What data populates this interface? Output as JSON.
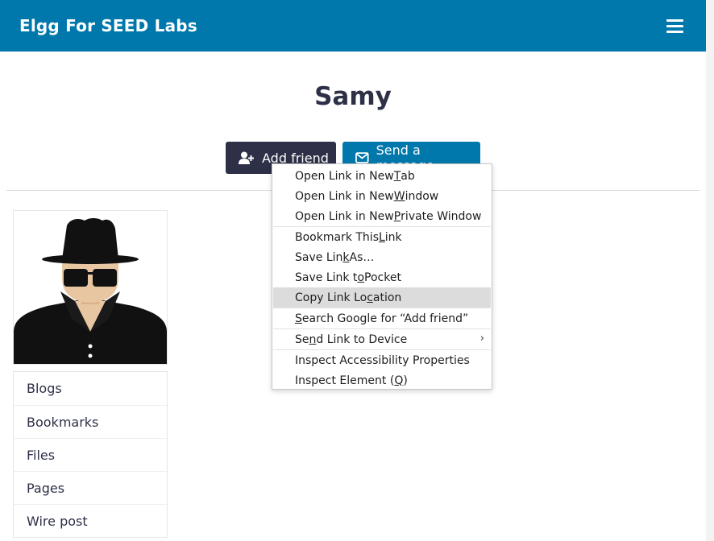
{
  "header": {
    "site_name": "Elgg For SEED Labs"
  },
  "profile": {
    "name": "Samy"
  },
  "actions": {
    "add_friend": "Add friend",
    "send_message": "Send a message"
  },
  "owner_menu": {
    "items": [
      "Blogs",
      "Bookmarks",
      "Files",
      "Pages",
      "Wire post"
    ]
  },
  "context_menu": {
    "items": [
      {
        "pre": "Open Link in New ",
        "key": "T",
        "post": "ab"
      },
      {
        "pre": "Open Link in New ",
        "key": "W",
        "post": "indow"
      },
      {
        "pre": "Open Link in New ",
        "key": "P",
        "post": "rivate Window"
      },
      {
        "pre": "Bookmark This ",
        "key": "L",
        "post": "ink"
      },
      {
        "pre": "Save Lin",
        "key": "k",
        "post": " As…"
      },
      {
        "pre": "Save Link t",
        "key": "o",
        "post": " Pocket"
      },
      {
        "pre": "Copy Link Lo",
        "key": "c",
        "post": "ation"
      },
      {
        "pre": "",
        "key": "S",
        "post": "earch Google for “Add friend”"
      },
      {
        "pre": "Se",
        "key": "n",
        "post": "d Link to Device"
      },
      {
        "pre": "Inspect Accessibility Properties",
        "key": "",
        "post": ""
      },
      {
        "pre": "Inspect Element (",
        "key": "Q",
        "post": ")"
      }
    ],
    "highlighted": "Copy Link Location"
  },
  "colors": {
    "brand": "#0078ac",
    "dark": "#2d3047",
    "highlight": "#dcdcdc"
  }
}
